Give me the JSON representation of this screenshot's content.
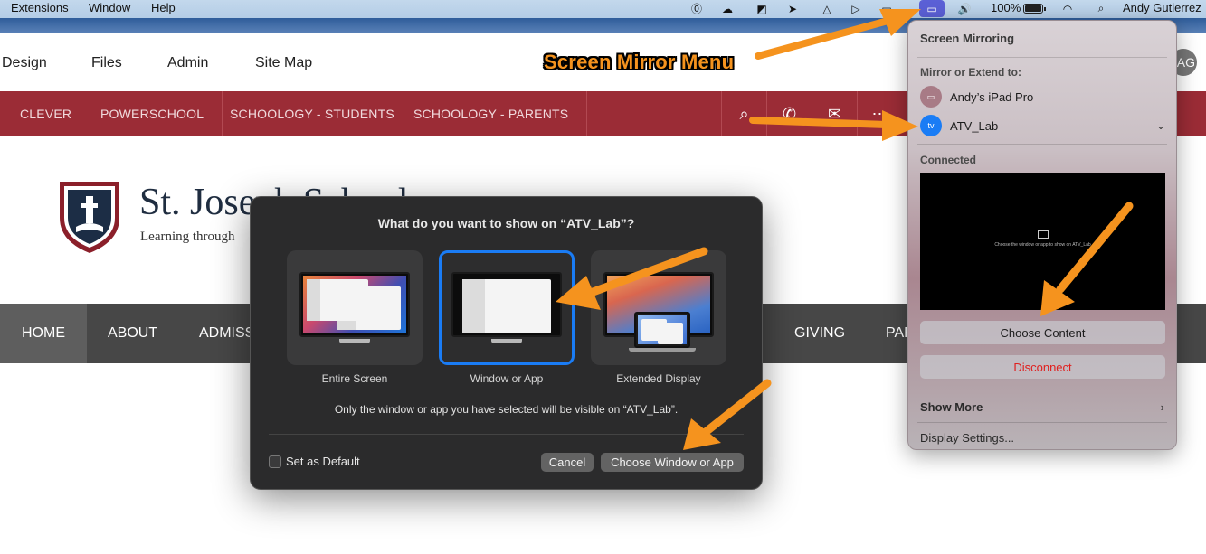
{
  "menubar": {
    "items": [
      "Extensions",
      "Window",
      "Help"
    ],
    "battery": "100%",
    "user": "Andy Gutierrez",
    "battery_level": 1.0,
    "icons": [
      "onepassword-icon",
      "creative-cloud-icon",
      "adobe-icon",
      "arrow-app-icon",
      "drive-icon",
      "play-icon",
      "zoom-icon",
      "screen-mirroring-icon",
      "volume-icon",
      "battery-icon",
      "wifi-icon",
      "spotlight-search-icon"
    ]
  },
  "site": {
    "top_links": [
      "Design",
      "Files",
      "Admin",
      "Site Map"
    ],
    "avatar_initials": "AG",
    "red_links": [
      "CLEVER",
      "POWERSCHOOL",
      "SCHOOLOGY - STUDENTS",
      "SCHOOLOGY - PARENTS"
    ],
    "red_icons": [
      "search-icon",
      "phone-icon",
      "mail-icon",
      "more-icon"
    ],
    "school_name": "St. Joseph School",
    "school_tag": "Learning through",
    "main_nav": [
      "HOME",
      "ABOUT",
      "ADMISS",
      "GIVING",
      "PAR"
    ]
  },
  "callout": "Screen Mirror Menu",
  "dialog": {
    "title": "What do you want to show on “ATV_Lab”?",
    "options": [
      {
        "label": "Entire Screen",
        "selected": false
      },
      {
        "label": "Window or App",
        "selected": true
      },
      {
        "label": "Extended Display",
        "selected": false
      }
    ],
    "info": "Only the window or app you have selected will be visible on “ATV_Lab”.",
    "default_label": "Set as Default",
    "default_checked": false,
    "cancel": "Cancel",
    "confirm": "Choose Window or App"
  },
  "mirror_menu": {
    "title": "Screen Mirroring",
    "subtitle": "Mirror or Extend to:",
    "devices": [
      {
        "name": "Andy’s iPad Pro",
        "icon": "ipad-icon",
        "color": "#a87b86"
      },
      {
        "name": "ATV_Lab",
        "icon": "appletv-icon",
        "color": "#1a7cf5",
        "badge": "tv"
      }
    ],
    "connected_label": "Connected",
    "preview_text": "Choose the window or app to show on ATV_Lab",
    "choose_content": "Choose Content",
    "disconnect": "Disconnect",
    "disconnect_color": "#e0201f",
    "show_more": "Show More",
    "display_settings": "Display Settings..."
  },
  "colors": {
    "accent": "#1a7cf5",
    "brand_red": "#9b2c36",
    "arrow_orange": "#f5931e"
  }
}
